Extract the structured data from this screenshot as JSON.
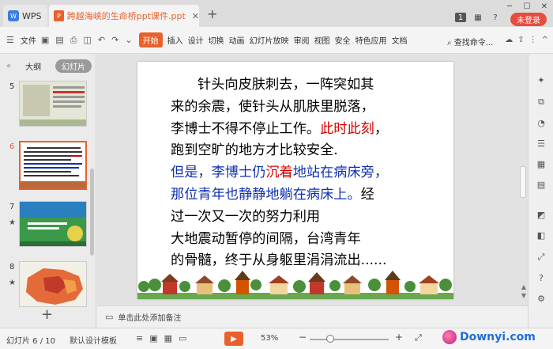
{
  "titlebar": {
    "app_tab": "WPS",
    "doc_tab": "跨越海峡的生命桥ppt课件.ppt",
    "login": "未登录"
  },
  "menubar": {
    "file": "文件",
    "start": "开始",
    "items": [
      "插入",
      "设计",
      "切换",
      "动画",
      "幻灯片放映",
      "审阅",
      "视图",
      "安全",
      "特色应用",
      "文档"
    ],
    "search": "查找命令..."
  },
  "leftpanel": {
    "tab_outline": "大纲",
    "tab_slides": "幻灯片",
    "slides": [
      {
        "num": "5",
        "active": false
      },
      {
        "num": "6",
        "active": true
      },
      {
        "num": "7",
        "active": false
      },
      {
        "num": "8",
        "active": false
      }
    ]
  },
  "slide": {
    "lines": [
      {
        "segments": [
          {
            "text": "针头向皮肤刺去，一阵突如其",
            "color": "black"
          }
        ],
        "indent": true
      },
      {
        "segments": [
          {
            "text": "来的余震，使针头从肌肤里脱落，",
            "color": "black"
          }
        ],
        "indent": false
      },
      {
        "segments": [
          {
            "text": "李博士不得不停止工作。",
            "color": "black"
          },
          {
            "text": "此时此刻",
            "color": "red"
          },
          {
            "text": "，",
            "color": "black"
          }
        ],
        "indent": false
      },
      {
        "segments": [
          {
            "text": "跑到空旷的地方才比较安全.",
            "color": "black"
          }
        ],
        "indent": false
      },
      {
        "segments": [
          {
            "text": "但是，李博士仍",
            "color": "blue"
          },
          {
            "text": "沉着",
            "color": "red"
          },
          {
            "text": "地站在病床旁，",
            "color": "blue"
          }
        ],
        "indent": false
      },
      {
        "segments": [
          {
            "text": "那位青年也静静地躺在病床上。",
            "color": "blue"
          },
          {
            "text": "经",
            "color": "black"
          }
        ],
        "indent": false
      },
      {
        "segments": [
          {
            "text": "过一次又一次的努力利用",
            "color": "black"
          }
        ],
        "indent": false
      },
      {
        "segments": [
          {
            "text": "大地震动暂停的间隔，台湾青年",
            "color": "black"
          }
        ],
        "indent": false
      },
      {
        "segments": [
          {
            "text": "的骨髓，终于从身躯里涓涓流出......",
            "color": "black"
          }
        ],
        "indent": false
      }
    ]
  },
  "notes": {
    "placeholder": "单击此处添加备注"
  },
  "statusbar": {
    "slide_count": "幻灯片 6 / 10",
    "template": "默认设计模板",
    "zoom": "53%",
    "zoom_fraction": 0.53
  },
  "watermark": {
    "text": "Downyi.com"
  }
}
